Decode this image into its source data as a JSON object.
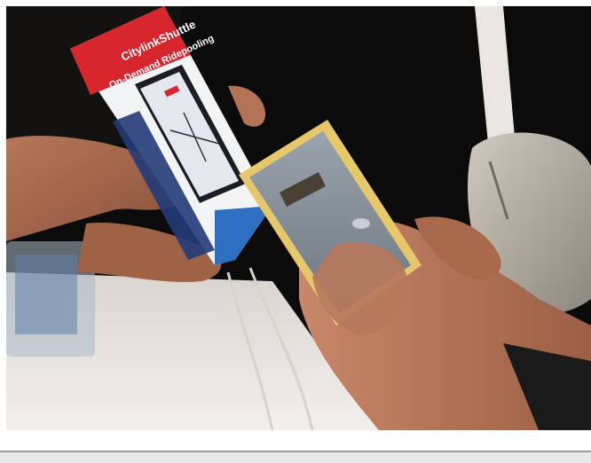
{
  "brochure": {
    "brand": "CitylinkShuttle",
    "headline": "On-Demand Ridepooling"
  },
  "colors": {
    "brochure_red": "#d8262f",
    "brochure_navy": "#223b78",
    "brochure_blue": "#2f6fc2",
    "phone_case": "#e6c76a",
    "background": "#0c0b0b"
  }
}
